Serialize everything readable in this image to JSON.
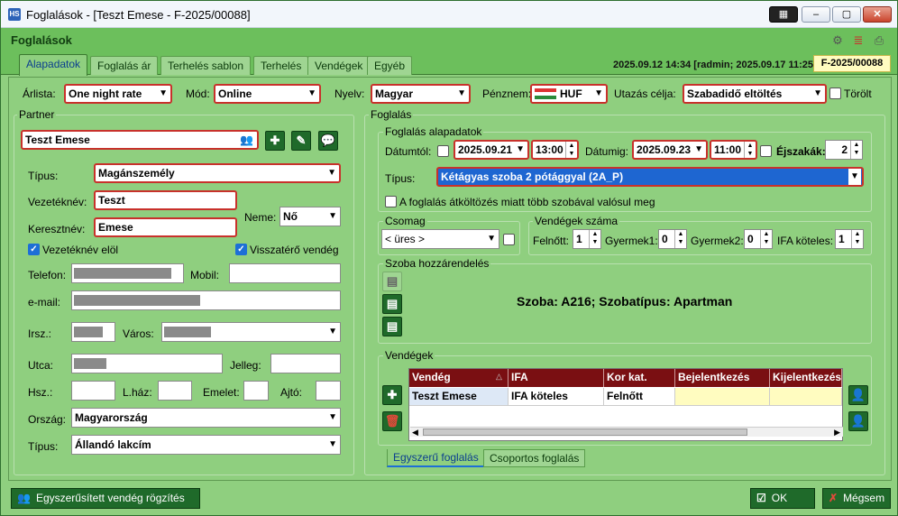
{
  "window": {
    "title": "Foglalások - [Teszt Emese - F-2025/00088]",
    "app_icon": "HS",
    "min": "–",
    "max": "▢",
    "close": "✕"
  },
  "header": {
    "title": "Foglalások"
  },
  "tabs": [
    "Alapadatok",
    "Foglalás ár",
    "Terhelés sablon",
    "Terhelés",
    "Vendégek",
    "Egyéb"
  ],
  "timestamp": "2025.09.12 14:34 [radmin; 2025.09.17 11:25]",
  "doc_number": "F-2025/00088",
  "top": {
    "arlista_label": "Árlista:",
    "arlista": "One night rate",
    "mod_label": "Mód:",
    "mod": "Online",
    "nyelv_label": "Nyelv:",
    "nyelv": "Magyar",
    "penznem_label": "Pénznem:",
    "penznem": "HUF",
    "utazas_label": "Utazás célja:",
    "utazas": "Szabadidő eltöltés",
    "torolt_label": "Törölt"
  },
  "partner": {
    "section": "Partner",
    "name": "Teszt Emese",
    "tipus_label": "Típus:",
    "tipus": "Magánszemély",
    "vezeteknev_label": "Vezetéknév:",
    "vezeteknev": "Teszt",
    "keresztnev_label": "Keresztnév:",
    "keresztnev": "Emese",
    "neme_label": "Neme:",
    "neme": "Nő",
    "vez_elol_label": "Vezetéknév elöl",
    "visszatero_label": "Visszatérő vendég",
    "telefon_label": "Telefon:",
    "mobil_label": "Mobil:",
    "email_label": "e-mail:",
    "irsz_label": "Irsz.:",
    "varos_label": "Város:",
    "utca_label": "Utca:",
    "jelleg_label": "Jelleg:",
    "hsz_label": "Hsz.:",
    "lhaz_label": "L.ház:",
    "emelet_label": "Emelet:",
    "ajto_label": "Ajtó:",
    "orszag_label": "Ország:",
    "orszag": "Magyarország",
    "tipus2_label": "Típus:",
    "tipus2": "Állandó lakcím"
  },
  "foglalas": {
    "section": "Foglalás",
    "alap": "Foglalás alapadatok",
    "datumtol_label": "Dátumtól:",
    "datumtol": "2025.09.21",
    "ido_tol": "13:00",
    "datumig_label": "Dátumig:",
    "datumig": "2025.09.23",
    "ido_ig": "11:00",
    "ejszakak_label": "Éjszakák:",
    "ejszakak": "2",
    "tipus_label": "Típus:",
    "tipus": "Kétágyas szoba 2 pótággyal (2A_P)",
    "atkoltozes_label": "A foglalás átköltözés miatt több szobával valósul meg",
    "csomag_label": "Csomag",
    "csomag": "< üres >",
    "vendegek_szama_label": "Vendégek száma",
    "felnott_label": "Felnőtt:",
    "felnott": "1",
    "gyermek1_label": "Gyermek1:",
    "gyermek1": "0",
    "gyermek2_label": "Gyermek2:",
    "gyermek2": "0",
    "ifa_label": "IFA köteles:",
    "ifa": "1",
    "szoba_label": "Szoba hozzárendelés",
    "szoba_info": "Szoba: A216; Szobatípus: Apartman",
    "vendegek_label": "Vendégek"
  },
  "grid": {
    "headers": [
      "Vendég",
      "IFA",
      "Kor kat.",
      "Bejelentkezés",
      "Kijelentkezés"
    ],
    "row": [
      "Teszt Emese",
      "IFA köteles",
      "Felnőtt",
      "",
      ""
    ]
  },
  "bottom_tabs": [
    "Egyszerű foglalás",
    "Csoportos foglalás"
  ],
  "footer": {
    "quick_guest": "Egyszerűsített vendég rögzítés",
    "ok": "OK",
    "cancel": "Mégsem"
  }
}
